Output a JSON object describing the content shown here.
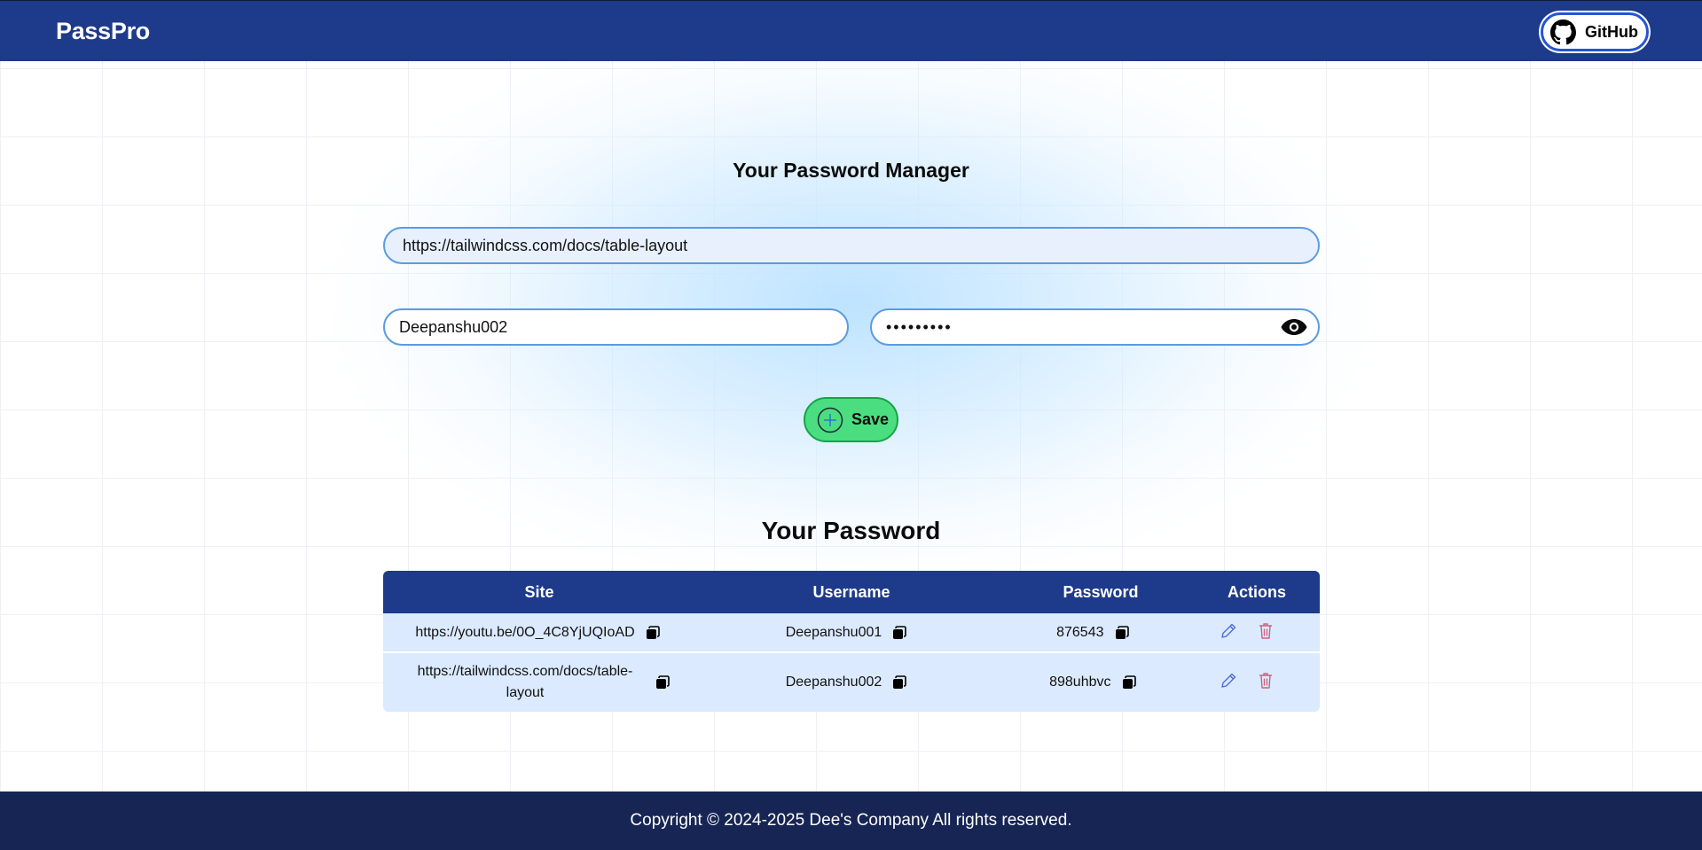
{
  "navbar": {
    "brand": "PassPro",
    "github_label": "GitHub"
  },
  "form": {
    "title": "Your Password Manager",
    "site_value": "https://tailwindcss.com/docs/table-layout",
    "username_value": "Deepanshu002",
    "password_value": "•••••••••",
    "save_label": "Save",
    "eye_icon": "eye-icon",
    "save_icon": "plus-circle-icon"
  },
  "table": {
    "title": "Your Password",
    "headers": [
      "Site",
      "Username",
      "Password",
      "Actions"
    ],
    "rows": [
      {
        "site": "https://youtu.be/0O_4C8YjUQIoAD",
        "username": "Deepanshu001",
        "password": "876543"
      },
      {
        "site": "https://tailwindcss.com/docs/table-layout",
        "username": "Deepanshu002",
        "password": "898uhbvc"
      }
    ]
  },
  "footer": {
    "copyright": "Copyright © 2024-2025 Dee's Company All rights reserved."
  },
  "colors": {
    "navbar": "#1e3a8a",
    "footer": "#172554",
    "save_button": "#4ade80",
    "table_header": "#1e3a8a",
    "table_row": "#dbeafe"
  }
}
